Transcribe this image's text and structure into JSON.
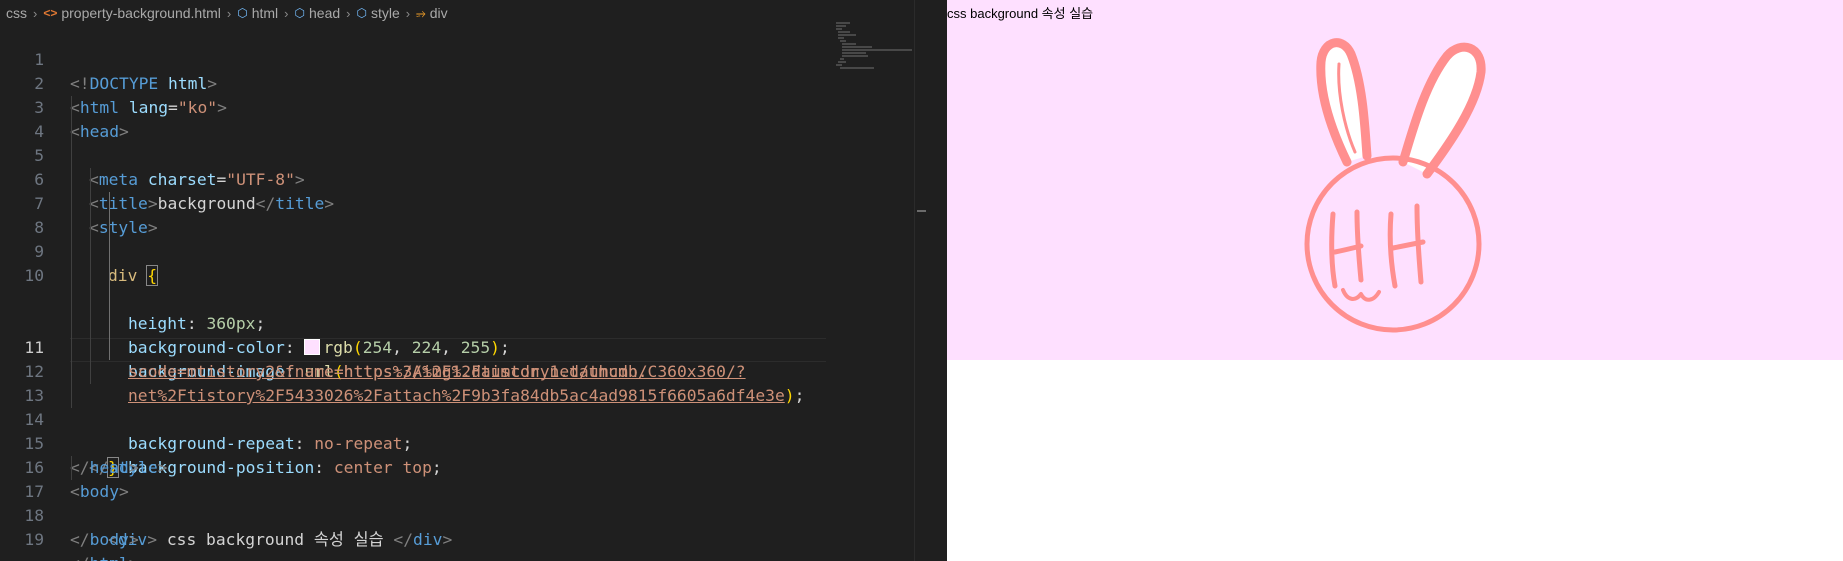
{
  "breadcrumb": [
    "css",
    "property-background.html",
    "html",
    "head",
    "style",
    "div"
  ],
  "breadcrumb_icons": [
    "chevron-right",
    "file-code-icon",
    "cube-icon",
    "cube-icon",
    "cube-icon",
    "symbol-class-icon"
  ],
  "code": {
    "line_numbers": [
      "1",
      "2",
      "3",
      "4",
      "5",
      "6",
      "7",
      "8",
      "9",
      "",
      "10",
      "",
      "",
      "11",
      "12",
      "13",
      "14",
      "15",
      "16",
      "17",
      "18",
      "19"
    ],
    "l1": {
      "a": "<!",
      "b": "DOCTYPE",
      "c": " html",
      "d": ">"
    },
    "l2": {
      "a": "<",
      "b": "html",
      "c": " lang",
      "d": "=",
      "e": "\"ko\"",
      "f": ">"
    },
    "l3": {
      "a": "<",
      "b": "head",
      "c": ">"
    },
    "l4": {
      "a": "<",
      "b": "meta",
      "c": " charset",
      "d": "=",
      "e": "\"UTF-8\"",
      "f": ">"
    },
    "l5": {
      "a": "<",
      "b": "title",
      "c": ">",
      "d": "background",
      "e": "</",
      "f": "title",
      "g": ">"
    },
    "l6": {
      "a": "<",
      "b": "style",
      "c": ">"
    },
    "l7": {
      "a": "div",
      "b": " ",
      "c": "{"
    },
    "l8": {
      "a": "height",
      "b": ": ",
      "c": "360px",
      "d": ";"
    },
    "l9": {
      "a": "background-color",
      "b": ": ",
      "c": "rgb",
      "d": "(",
      "e": "254",
      "f": ", ",
      "g": "224",
      "h": ", ",
      "i": "255",
      "j": ")",
      "k": ";"
    },
    "l10a": {
      "a": "background-image",
      "b": ": ",
      "c": "url",
      "d": "(",
      "e": "https://img1.daumcdn.net/thumb/C360x360/?"
    },
    "l10b": "scode=mtistory2&fname=https%3A%2F%2Ftistory1.daumcdn.",
    "l10c": {
      "a": "net%2Ftistory%2F5433026%2Fattach%2F9b3fa84db5ac4ad9815f6605a6df4e3e",
      "b": ")",
      "c": ";"
    },
    "l11": {
      "a": "background-repeat",
      "b": ": ",
      "c": "no-repeat",
      "d": ";"
    },
    "l12": {
      "a": "background-position",
      "b": ": ",
      "c": "center top",
      "d": ";"
    },
    "l13": {
      "a": "}"
    },
    "l14": {
      "a": "</",
      "b": "style",
      "c": ">"
    },
    "l15": {
      "a": "</",
      "b": "head",
      "c": ">"
    },
    "l16": {
      "a": "<",
      "b": "body",
      "c": ">"
    },
    "l17": {
      "a": "<",
      "b": "div",
      "c": ">",
      "d": " css background 속성 실습 ",
      "e": "</",
      "f": "div",
      "g": ">"
    },
    "l18": {
      "a": "</",
      "b": "body",
      "c": ">"
    },
    "l19": {
      "a": "</",
      "b": "html",
      "c": ">"
    }
  },
  "swatch_color": "#fee0ff",
  "preview": {
    "text": "css background 속성 실습",
    "background_color": "#fee0ff",
    "image": "bunny-face-drawing"
  }
}
